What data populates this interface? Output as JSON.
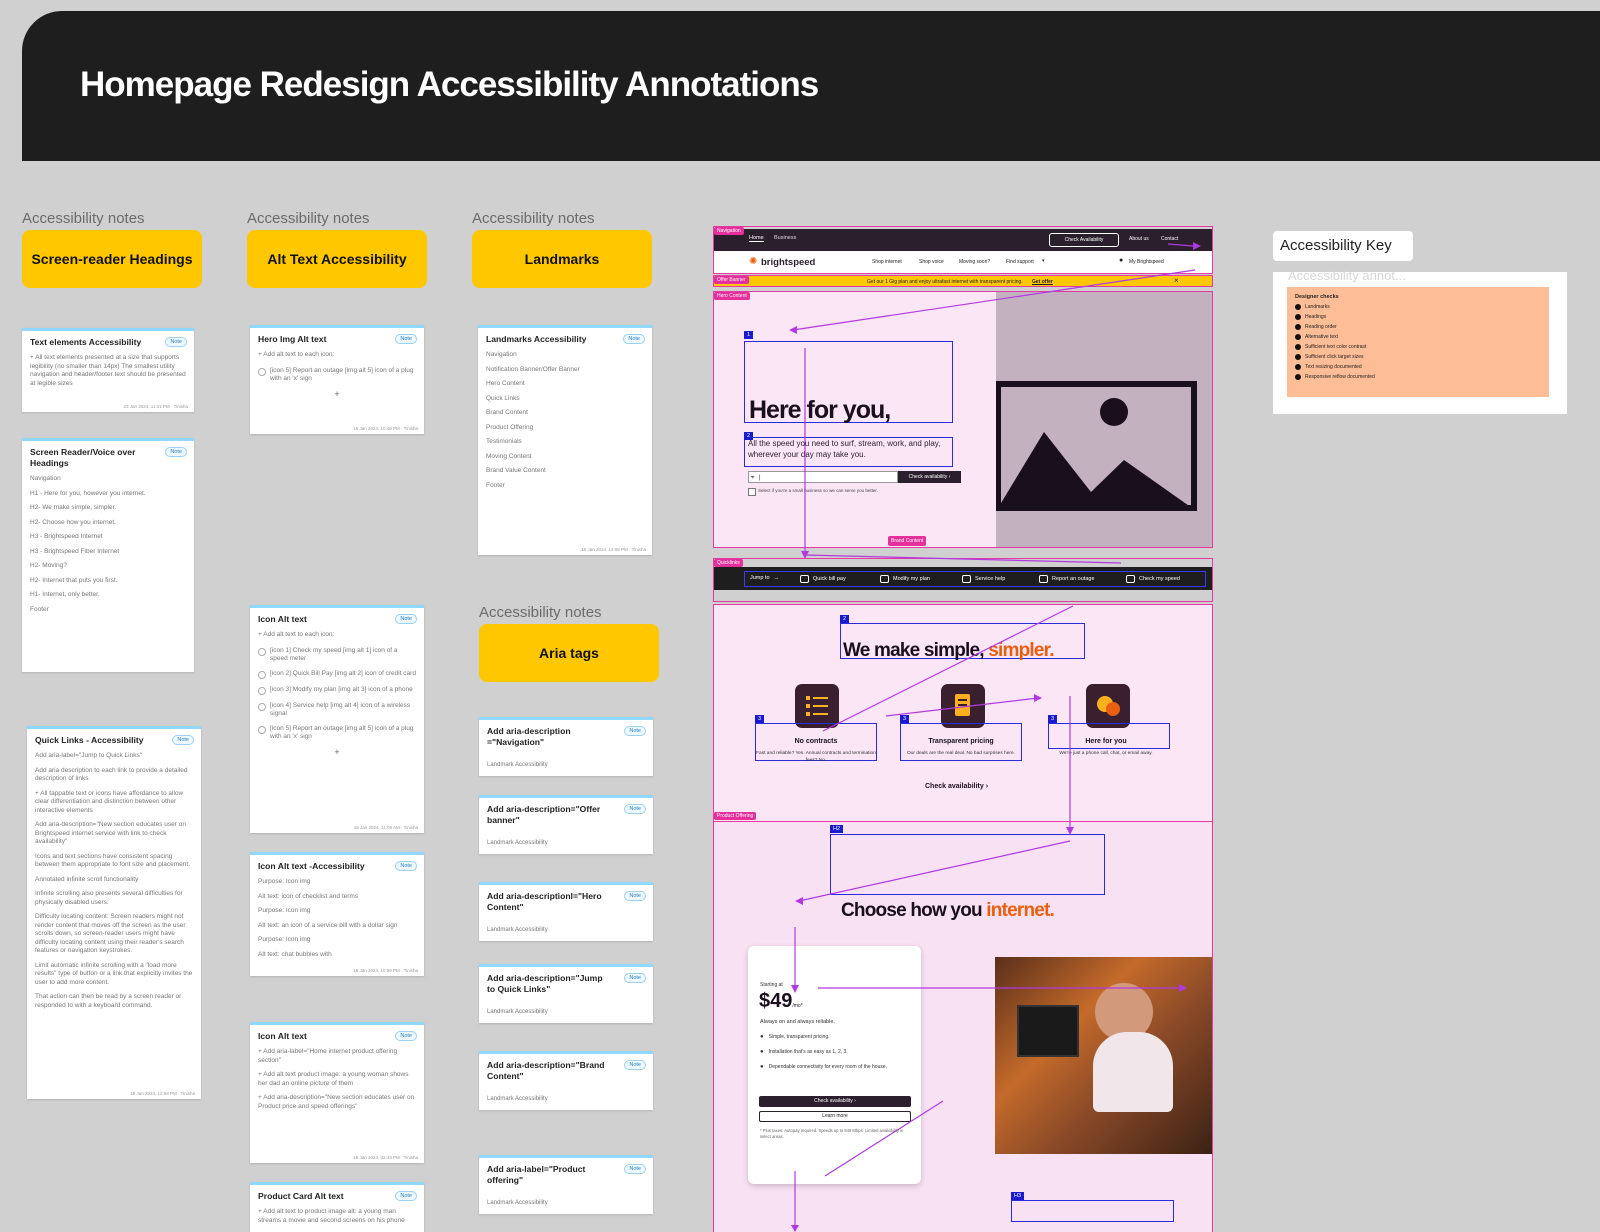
{
  "header": {
    "title": "Homepage Redesign Accessibility Annotations"
  },
  "section_label": "Accessibility notes",
  "columns": {
    "col1": "Screen-reader Headings",
    "col2": "Alt Text Accessibility",
    "col3": "Landmarks",
    "col4": "Aria tags"
  },
  "note_badge": "Note",
  "cards": {
    "text_elements": {
      "title": "Text elements Accessibility",
      "body": "+ All text elements presented at a size that supports legibility (no smaller than 14px) The smallest utility navigation and header/footer text should be presented at legible sizes",
      "meta": "23 Jan 2024, 11:41 PM · Tinisha"
    },
    "screen_reader": {
      "title": "Screen Reader/Voice over Headings",
      "items": [
        "Navigation",
        "H1 - Here for you, however you internet.",
        "H2- We make simple, simpler.",
        "H2- Choose how you internet.",
        "H3 - Brightspeed Internet",
        "H3 - Brightspeed Fiber Internet",
        "H2- Moving?",
        "H2- Internet that puts you first.",
        "H1- Internet, only better.",
        "Footer"
      ]
    },
    "quick_links": {
      "title": "Quick Links - Accessibility",
      "items": [
        "Add aria-label=\"Jump to Quick Links\"",
        "Add aria description to each link to provide a detailed description of links",
        "+ All tappable text or icons have affordance to allow clear differentiation and distinction between other interactive elements",
        "Add aria-description=\"New section educates user on Brightspeed internet service with link to check availability\"",
        "Icons and text sections have consistent spacing between them appropriate to font size and placement.",
        "Annotated infinite scroll functionality",
        "Infinite scrolling also presents several difficulties for physically disabled users:",
        "Difficulty locating content: Screen readers might not render content that moves off the screen as the user scrolls down, so screen-reader users might have difficulty locating content using their reader's search features or navigation keystrokes.",
        "Limit automatic infinite scrolling with a \"load more results\" type of button or a link that explicitly invites the user to add more content.",
        "That action can then be read by a screen reader or responded to with a keyboard command."
      ],
      "meta": "15 Jan 2024, 12:58 PM · Tinisha"
    },
    "hero_img": {
      "title": "Hero Img Alt text",
      "intro": "+ Add alt text to each icon:",
      "items": [
        "[icon 5] Report an outage [img alt 5] icon of a plug with an 'x' sign"
      ],
      "meta": "16 Jan 2024, 10:48 PM · Tinisha"
    },
    "icon_alt": {
      "title": "Icon Alt text",
      "intro": "+ Add alt text to each icon:",
      "items": [
        "[icon 1] Check my speed [img alt 1] icon of a speed meter",
        "[icon 2] Quick Bill Pay [img alt 2] icon of credit card",
        "[icon 3] Modify my plan [img alt 3] icon of a phone",
        "[icon 4] Service help [img alt 4] icon of a wireless signal",
        "[icon 5] Report an outage [img alt 5] icon of a plug with an 'x' sign"
      ],
      "meta": "16 Jan 2024, 11:05 AM · Tinisha"
    },
    "icon_alt_acc": {
      "title": "Icon Alt text -Accessibility",
      "items": [
        "Purpose: Icon img",
        "Alt text: icon of checklist and terms",
        "Purpose: Icon img",
        "Alt text: an icon of a service bill with a dollar sign",
        "Purpose: Icon img",
        "Alt text: chat bubbles with"
      ],
      "meta": "16 Jan 2024, 10:59 PM · Tinisha"
    },
    "icon_alt2": {
      "title": "Icon Alt text",
      "items": [
        "+ Add aria-label=\"Home internet product offering section\"",
        "+ Add alt text product image: a young woman shows her dad an online picture of them",
        "+ Add aria-description=\"New section educates user on Product price and speed offerings\""
      ],
      "meta": "16 Jan 2024, 02:43 PM · Tinisha"
    },
    "product_card": {
      "title": "Product Card Alt text",
      "items": [
        "+ Add alt text to product image alt: a young man streams a movie and second screens on his phone"
      ]
    },
    "landmarks": {
      "title": "Landmarks Accessibility",
      "items": [
        "Navigation",
        "Notification Banner/Offer Banner",
        "Hero Content",
        "Quick Links",
        "Brand Content",
        "Product Offering",
        "Testimonials",
        "Moving Content",
        "Brand Value Content",
        "Footer"
      ],
      "meta": "16 Jan 2024, 12:08 PM · Tinisha"
    },
    "aria": [
      {
        "title": "Add aria-description =\"Navigation\"",
        "sub": "Landmark Accessibility"
      },
      {
        "title": "Add aria-description=\"Offer banner\"",
        "sub": "Landmark Accessibility"
      },
      {
        "title": "Add aria-descriptionl=\"Hero Content\"",
        "sub": "Landmark Accessibility"
      },
      {
        "title": "Add aria-description=\"Jump to Quick Links\"",
        "sub": "Landmark Accessibility"
      },
      {
        "title": "Add aria-description=\"Brand Content\"",
        "sub": "Landmark Accessibility"
      },
      {
        "title": "Add aria-label=\"Product offering\"",
        "sub": "Landmark Accessibility"
      }
    ]
  },
  "mockup": {
    "tags": {
      "navigation": "Navigation",
      "offer": "Offer Banner",
      "hero": "Hero Content",
      "quicklinks": "Quicklinks",
      "product": "Product Offering",
      "brand": "Brand Content"
    },
    "nav": {
      "home": "Home",
      "business": "Business",
      "check": "Check Availability",
      "about": "About us",
      "contact": "Contact"
    },
    "header": {
      "brand": "brightspeed",
      "links": [
        "Shop internet",
        "Shop voice",
        "Moving soon?",
        "Find support"
      ],
      "account": "My Brightspeed"
    },
    "offer": {
      "text": "Get our 1 Gig plan and enjoy ultrafast internet with transparent pricing.",
      "link": "Get offer",
      "close": "×"
    },
    "hero": {
      "h1": "Here for you,",
      "sub": "All the speed you need to surf, stream, work, and play, wherever your day may take you.",
      "cta": "Check availability",
      "checkbox": "Select if you're a small business so we can serve you better.",
      "input_value": "|"
    },
    "quick": {
      "jump": "Jump to",
      "items": [
        "Quick bill pay",
        "Modify my plan",
        "Service help",
        "Report an outage",
        "Check my speed"
      ]
    },
    "simple": {
      "h2a": "We make simple, ",
      "h2b": "simpler.",
      "features": [
        {
          "title": "No contracts",
          "desc": "Fast and reliable? Yes. Annual contracts and termination fees? No."
        },
        {
          "title": "Transparent pricing",
          "desc": "Our deals are the real deal. No bad surprises here."
        },
        {
          "title": "Here for you",
          "desc": "We're just a phone call, chat, or email away."
        }
      ],
      "cta": "Check availability"
    },
    "choose": {
      "h2a": "Choose how you ",
      "h2b": "internet.",
      "starting": "Starting at",
      "price": "$49",
      "per": "/mo*",
      "tagline": "Always on and always reliable.",
      "bullets": [
        "Simple, transparent pricing.",
        "Installation that's as easy as 1, 2, 3.",
        "Dependable connectivity for every room of the house."
      ],
      "cta1": "Check availability",
      "cta2": "Learn more",
      "fine": "* Plus taxes. Autopay required. Speeds up to 940 Mbps. Limited availability in select areas."
    },
    "labels": {
      "n1": "1",
      "n2": "2",
      "n3": "3",
      "h2": "H2",
      "h3": "H3"
    }
  },
  "key": {
    "title": "Accessibility Key",
    "faded": "Accessibility annot...",
    "heading": "Designer checks",
    "items": [
      "Landmarks",
      "Headings",
      "Reading order",
      "Alternative text",
      "Sufficient text color contrast",
      "Sufficient click target sizes",
      "Text resizing documented",
      "Responsive reflow documented"
    ]
  },
  "colors": {
    "yellow": "#ffc700",
    "accent": "#e8600f",
    "pink": "#e23aa1",
    "blue": "#2a2adf",
    "dark": "#1e1e1e",
    "mockup_bg": "#fbe6f6",
    "key_bg": "#fdbd96"
  }
}
